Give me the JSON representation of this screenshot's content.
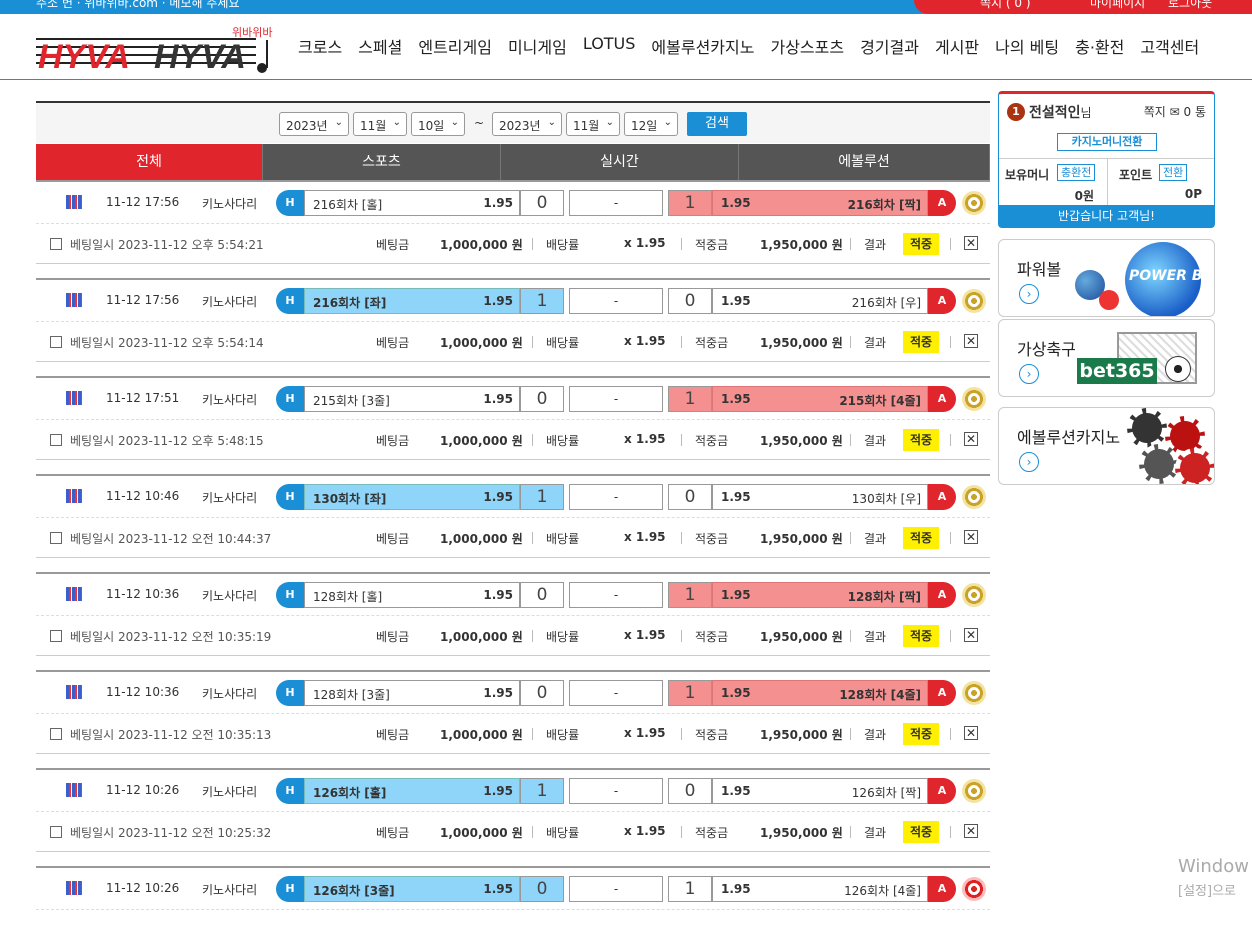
{
  "topbar": {
    "left": "주소 변 · 위바위바.com · 메모해 주세요",
    "right": [
      "쪽지 ( 0 )",
      "마이페이지",
      "로그아웃"
    ]
  },
  "header": {
    "logo_text": "HYVAHYVA",
    "logo_sub": "위바위바",
    "nav": [
      "크로스",
      "스페셜",
      "엔트리게임",
      "미니게임",
      "LOTUS",
      "에볼루션카지노",
      "가상스포츠",
      "경기결과",
      "게시판",
      "나의 베팅",
      "충·환전",
      "고객센터"
    ]
  },
  "search": {
    "from": [
      "2023년",
      "11월",
      "10일"
    ],
    "to": [
      "2023년",
      "11월",
      "12일"
    ],
    "tilde": "~",
    "button": "검색"
  },
  "tabs": [
    "전체",
    "스포츠",
    "실시간",
    "에볼루션"
  ],
  "labels": {
    "bet_amount": "베팅금",
    "odds": "배당률",
    "win_amount": "적중금",
    "result": "결과",
    "dash": "-"
  },
  "bets": [
    {
      "time": "11-12 17:56",
      "league": "키노사다리",
      "h": "H",
      "home": "216회차 [홀]",
      "home_odds": "1.95",
      "hs": "0",
      "as": "1",
      "away_odds": "1.95",
      "away": "216회차 [짝]",
      "a": "A",
      "pick": "away",
      "bet_date": "베팅일시 2023-11-12 오후 5:54:21",
      "amount": "1,000,000 원",
      "mult": "x 1.95",
      "win": "1,950,000 원",
      "result": "적중"
    },
    {
      "time": "11-12 17:56",
      "league": "키노사다리",
      "h": "H",
      "home": "216회차 [좌]",
      "home_odds": "1.95",
      "hs": "1",
      "as": "0",
      "away_odds": "1.95",
      "away": "216회차 [우]",
      "a": "A",
      "pick": "home",
      "bet_date": "베팅일시 2023-11-12 오후 5:54:14",
      "amount": "1,000,000 원",
      "mult": "x 1.95",
      "win": "1,950,000 원",
      "result": "적중"
    },
    {
      "time": "11-12 17:51",
      "league": "키노사다리",
      "h": "H",
      "home": "215회차 [3줄]",
      "home_odds": "1.95",
      "hs": "0",
      "as": "1",
      "away_odds": "1.95",
      "away": "215회차 [4줄]",
      "a": "A",
      "pick": "away",
      "bet_date": "베팅일시 2023-11-12 오후 5:48:15",
      "amount": "1,000,000 원",
      "mult": "x 1.95",
      "win": "1,950,000 원",
      "result": "적중"
    },
    {
      "time": "11-12 10:46",
      "league": "키노사다리",
      "h": "H",
      "home": "130회차 [좌]",
      "home_odds": "1.95",
      "hs": "1",
      "as": "0",
      "away_odds": "1.95",
      "away": "130회차 [우]",
      "a": "A",
      "pick": "home",
      "bet_date": "베팅일시 2023-11-12 오전 10:44:37",
      "amount": "1,000,000 원",
      "mult": "x 1.95",
      "win": "1,950,000 원",
      "result": "적중"
    },
    {
      "time": "11-12 10:36",
      "league": "키노사다리",
      "h": "H",
      "home": "128회차 [홀]",
      "home_odds": "1.95",
      "hs": "0",
      "as": "1",
      "away_odds": "1.95",
      "away": "128회차 [짝]",
      "a": "A",
      "pick": "away",
      "bet_date": "베팅일시 2023-11-12 오전 10:35:19",
      "amount": "1,000,000 원",
      "mult": "x 1.95",
      "win": "1,950,000 원",
      "result": "적중"
    },
    {
      "time": "11-12 10:36",
      "league": "키노사다리",
      "h": "H",
      "home": "128회차 [3줄]",
      "home_odds": "1.95",
      "hs": "0",
      "as": "1",
      "away_odds": "1.95",
      "away": "128회차 [4줄]",
      "a": "A",
      "pick": "away",
      "bet_date": "베팅일시 2023-11-12 오전 10:35:13",
      "amount": "1,000,000 원",
      "mult": "x 1.95",
      "win": "1,950,000 원",
      "result": "적중"
    },
    {
      "time": "11-12 10:26",
      "league": "키노사다리",
      "h": "H",
      "home": "126회차 [홀]",
      "home_odds": "1.95",
      "hs": "1",
      "as": "0",
      "away_odds": "1.95",
      "away": "126회차 [짝]",
      "a": "A",
      "pick": "home",
      "bet_date": "베팅일시 2023-11-12 오전 10:25:32",
      "amount": "1,000,000 원",
      "mult": "x 1.95",
      "win": "1,950,000 원",
      "result": "적중"
    },
    {
      "time": "11-12 10:26",
      "league": "키노사다리",
      "h": "H",
      "home": "126회차 [3줄]",
      "home_odds": "1.95",
      "hs": "0",
      "as": "1",
      "away_odds": "1.95",
      "away": "126회차 [4줄]",
      "a": "A",
      "pick": "home",
      "bet_date": "",
      "amount": "",
      "mult": "",
      "win": "",
      "result": "",
      "lost": true
    }
  ],
  "user": {
    "level": "1",
    "name": "전설적인",
    "suffix": "님",
    "messages": "쪽지 ✉ 0 통",
    "casino_button": "카지노머니전환",
    "money_label": "보유머니",
    "money_button": "충환전",
    "money_value": "0원",
    "point_label": "포인트",
    "point_button": "전환",
    "point_value": "0P",
    "welcome": "반갑습니다 고객님!"
  },
  "promos": [
    {
      "title": "파워볼",
      "art": "POWER BALL"
    },
    {
      "title": "가상축구",
      "art": "bet365"
    },
    {
      "title": "에볼루션카지노",
      "art": ""
    }
  ],
  "watermark": {
    "line1": "Window",
    "line2": "[설정]으로"
  },
  "colors": {
    "accent": "#1a8fd6",
    "red": "#e0262c",
    "pick_blue": "#8fd4f9",
    "pick_red": "#f59090",
    "win_badge": "#ffef00"
  }
}
